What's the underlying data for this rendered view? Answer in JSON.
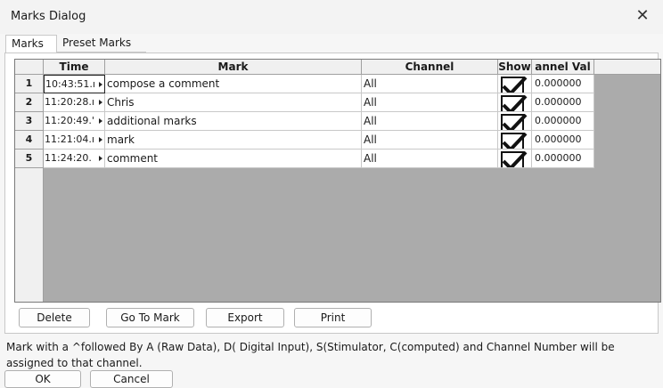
{
  "window": {
    "title": "Marks Dialog",
    "close_glyph": "✕"
  },
  "tabs": [
    {
      "label": "Marks",
      "active": true
    },
    {
      "label": "Preset Marks",
      "active": false
    }
  ],
  "grid": {
    "columns": [
      "Time",
      "Mark",
      "Channel",
      "Show",
      "annel Val"
    ],
    "rows": [
      {
        "num": "1",
        "time": "10:43:51.ı",
        "mark": "compose a comment",
        "channel": "All",
        "show": true,
        "value": "0.000000"
      },
      {
        "num": "2",
        "time": "11:20:28.ı",
        "mark": "Chris",
        "channel": "All",
        "show": true,
        "value": "0.000000"
      },
      {
        "num": "3",
        "time": "11:20:49.'",
        "mark": "additional marks",
        "channel": "All",
        "show": true,
        "value": "0.000000"
      },
      {
        "num": "4",
        "time": "11:21:04.ı",
        "mark": "mark",
        "channel": "All",
        "show": true,
        "value": "0.000000"
      },
      {
        "num": "5",
        "time": "11:24:20.",
        "mark": "comment",
        "channel": "All",
        "show": true,
        "value": "0.000000"
      }
    ]
  },
  "actions": {
    "delete": "Delete",
    "goto": "Go To Mark",
    "export": "Export",
    "print": "Print"
  },
  "note": "Mark with a ^followed By A (Raw Data), D( Digital Input), S(Stimulator, C(computed) and Channel Number will be assigned to that channel.",
  "footer": {
    "ok": "OK",
    "cancel": "Cancel"
  },
  "icons": {
    "close": "close-icon",
    "check": "checkmark-icon",
    "cell_arrow": "dropdown-arrow-icon"
  },
  "colors": {
    "grid_background": "#ababab",
    "header_background": "#f0f0f0",
    "window_background": "#f6f6f6"
  }
}
